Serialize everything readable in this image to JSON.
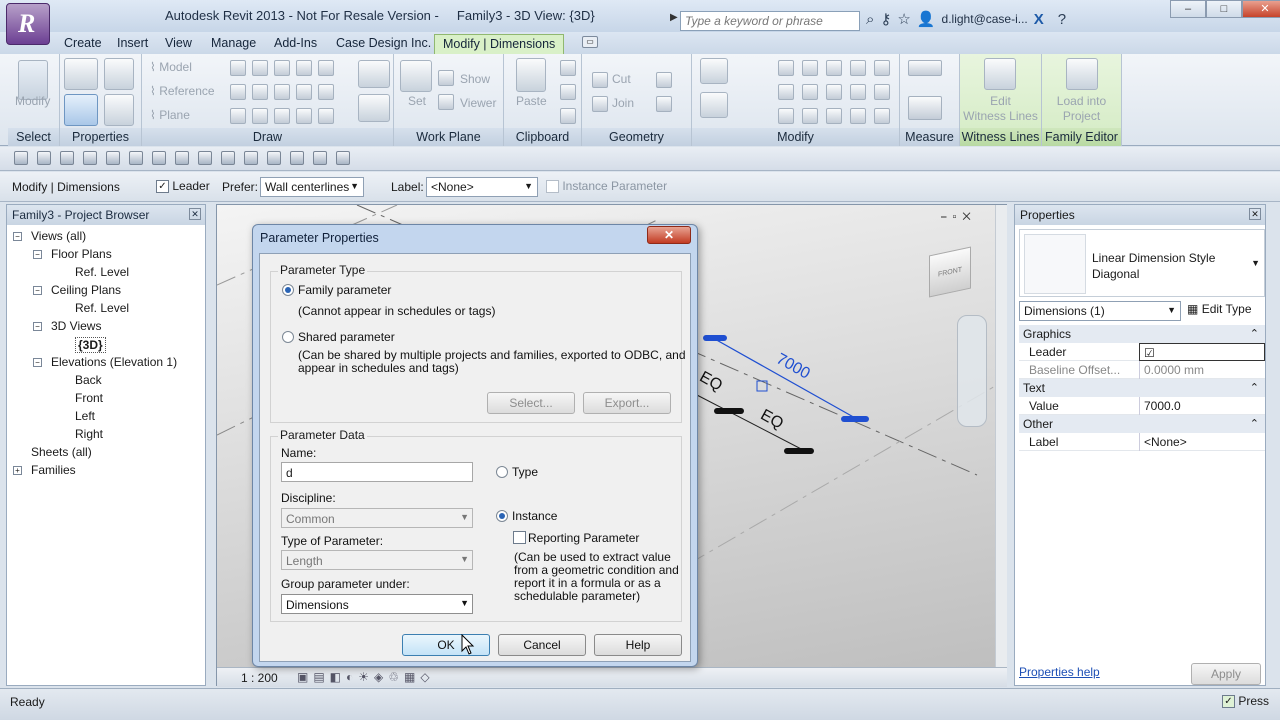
{
  "window": {
    "title": "Autodesk Revit 2013 - Not For Resale Version -",
    "doc_title": "Family3 - 3D View: {3D}",
    "search_placeholder": "Type a keyword or phrase",
    "user": "d.light@case-i...",
    "app_letter": "R",
    "window_buttons": [
      "‒",
      "□",
      "✕"
    ]
  },
  "tabs": [
    "Create",
    "Insert",
    "View",
    "Manage",
    "Add-Ins",
    "Case Design Inc.",
    "Modify | Dimensions"
  ],
  "ribbon": {
    "select": {
      "button": "Modify",
      "label": "Select"
    },
    "properties": {
      "label": "Properties"
    },
    "draw": {
      "label": "Draw",
      "items": [
        "Model",
        "Reference",
        "Plane"
      ]
    },
    "work_plane": {
      "label": "Work Plane",
      "items": [
        "Set",
        "Show",
        "Viewer"
      ]
    },
    "clipboard": {
      "label": "Clipboard",
      "items": [
        "Paste"
      ]
    },
    "geometry": {
      "label": "Geometry",
      "items": [
        "Cut",
        "Join"
      ]
    },
    "modify": {
      "label": "Modify"
    },
    "measure": {
      "label": "Measure"
    },
    "witness_lines": {
      "label": "Witness Lines",
      "button_line1": "Edit",
      "button_line2": "Witness Lines"
    },
    "family_editor": {
      "label": "Family Editor",
      "button_line1": "Load into",
      "button_line2": "Project"
    }
  },
  "optbar": {
    "context": "Modify | Dimensions",
    "leader_label": "Leader",
    "prefer_label": "Prefer:",
    "prefer_value": "Wall centerlines",
    "label_label": "Label:",
    "label_value": "<None>",
    "instance_param": "Instance Parameter"
  },
  "browser": {
    "title": "Family3 - Project Browser",
    "items": [
      {
        "text": "Views (all)",
        "level": 0,
        "exp": "−"
      },
      {
        "text": "Floor Plans",
        "level": 1,
        "exp": "−"
      },
      {
        "text": "Ref. Level",
        "level": 2
      },
      {
        "text": "Ceiling Plans",
        "level": 1,
        "exp": "−"
      },
      {
        "text": "Ref. Level",
        "level": 2
      },
      {
        "text": "3D Views",
        "level": 1,
        "exp": "−"
      },
      {
        "text": "{3D}",
        "level": 2,
        "bold": true
      },
      {
        "text": "Elevations (Elevation 1)",
        "level": 1,
        "exp": "−"
      },
      {
        "text": "Back",
        "level": 2
      },
      {
        "text": "Front",
        "level": 2
      },
      {
        "text": "Left",
        "level": 2
      },
      {
        "text": "Right",
        "level": 2
      },
      {
        "text": "Sheets (all)",
        "level": 0
      },
      {
        "text": "Families",
        "level": 0,
        "exp": "+"
      }
    ]
  },
  "canvas": {
    "dim_value": "7000",
    "eq1": "EQ",
    "eq2": "EQ",
    "scale": "1 : 200",
    "viewcube_label": "FRONT"
  },
  "properties": {
    "title": "Properties",
    "type_line1": "Linear Dimension Style",
    "type_line2": "Diagonal",
    "filter": "Dimensions (1)",
    "edit_type": "Edit Type",
    "sections": [
      {
        "name": "Graphics",
        "rows": [
          {
            "k": "Leader",
            "v": "☑"
          },
          {
            "k": "Baseline Offset...",
            "v": "0.0000 mm"
          }
        ]
      },
      {
        "name": "Text",
        "rows": [
          {
            "k": "Value",
            "v": "7000.0"
          }
        ]
      },
      {
        "name": "Other",
        "rows": [
          {
            "k": "Label",
            "v": "<None>"
          }
        ]
      }
    ],
    "help_link": "Properties help",
    "apply": "Apply"
  },
  "status": {
    "text": "Ready",
    "press": "Press"
  },
  "dialog": {
    "title": "Parameter Properties",
    "close": "✕",
    "param_type_group": "Parameter Type",
    "family_param": "Family parameter",
    "family_note": "(Cannot appear in schedules or tags)",
    "shared_param": "Shared parameter",
    "shared_note1": "(Can be shared by multiple projects and families, exported to ODBC, and",
    "shared_note2": "appear in schedules and tags)",
    "select_btn": "Select...",
    "export_btn": "Export...",
    "param_data_group": "Parameter Data",
    "name_label": "Name:",
    "name_value": "d",
    "type_radio": "Type",
    "discipline_label": "Discipline:",
    "discipline_value": "Common",
    "instance_radio": "Instance",
    "reporting": "Reporting Parameter",
    "reporting_note1": "(Can be used to extract value",
    "reporting_note2": "from a geometric condition and",
    "reporting_note3": "report it in a formula or as a",
    "reporting_note4": "schedulable parameter)",
    "type_of_param_label": "Type of Parameter:",
    "type_of_param_value": "Length",
    "group_label": "Group parameter under:",
    "group_value": "Dimensions",
    "ok": "OK",
    "cancel": "Cancel",
    "help": "Help"
  }
}
